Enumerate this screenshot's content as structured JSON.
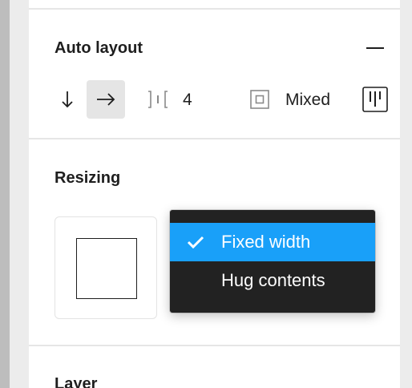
{
  "auto_layout": {
    "title": "Auto layout",
    "collapse_icon": "minus-icon",
    "direction_vertical_icon": "arrow-down-icon",
    "direction_horizontal_icon": "arrow-right-icon",
    "spacing_icon": "spacing-icon",
    "spacing_value": "4",
    "padding_icon": "padding-icon",
    "padding_value": "Mixed",
    "alignment_icon": "alignment-icon"
  },
  "resizing": {
    "title": "Resizing",
    "options": [
      {
        "label": "Fixed width",
        "selected": true
      },
      {
        "label": "Hug contents",
        "selected": false
      }
    ]
  },
  "layer": {
    "title": "Layer"
  },
  "colors": {
    "accent": "#19a0f9",
    "menu_bg": "#222222"
  }
}
